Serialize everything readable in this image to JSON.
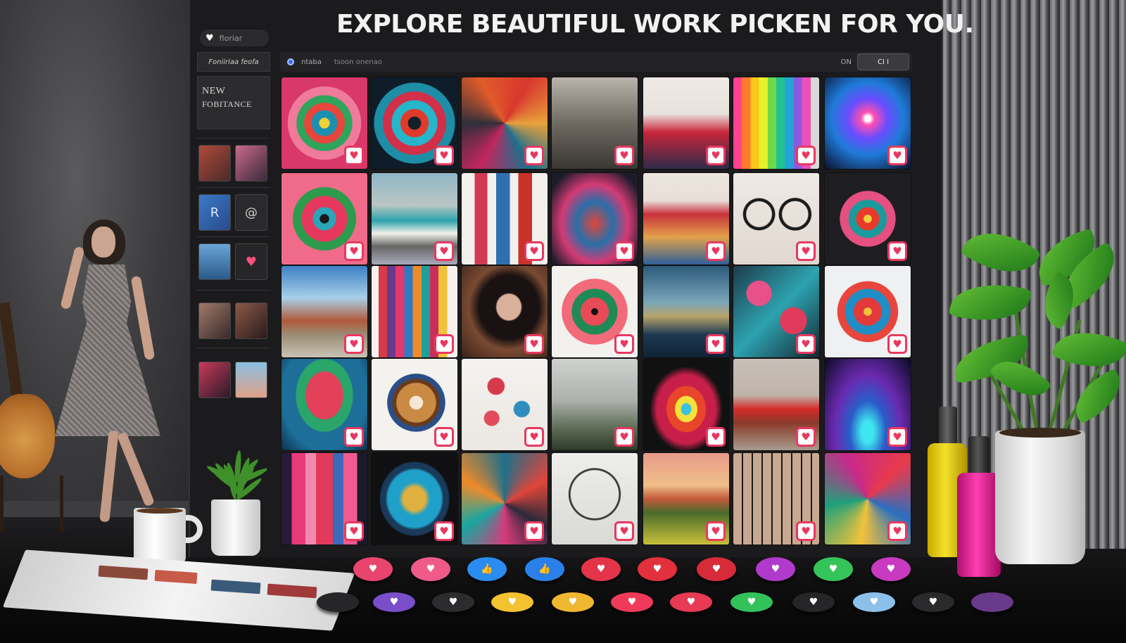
{
  "headline": "EXPLORE BEAUTIFUL WORK PICKEN FOR YOU.",
  "sidebar": {
    "pill_label": "floriar",
    "heart_icon": "heart-icon",
    "tag_label": "Foniiriaa feofa",
    "card_line1": "NEW",
    "card_line2": "FOBITANCE"
  },
  "topbar": {
    "label1": "ntaba",
    "label2": "tsoon onenao",
    "zoom": "ON",
    "control": "CI I"
  },
  "like_glyph": "♥",
  "tiles": [
    {
      "name": "tile-mandala-flowers",
      "bg": "radial-gradient(circle at 50% 50%, #f0d23a 0 8%, #1c8fb0 9% 20%, #e8453c 21% 32%, #2fa45c 33% 44%, #f07a9a 45% 58%, #d9386a 59% 100%)"
    },
    {
      "name": "tile-teal-mandala",
      "bg": "radial-gradient(circle at 50% 50%, #142028 0 10%, #e23a2a 11% 22%, #26b5c9 23% 36%, #d22f48 37% 50%, #1d8ea6 51% 64%, #0f1d2a 65% 100%)"
    },
    {
      "name": "tile-color-collage",
      "bg": "conic-gradient(from 30deg, #d8372e, #e9a13b, #1f6f8c, #c0265e, #2f2f3a, #e15b2a, #d8372e)"
    },
    {
      "name": "tile-window-room",
      "bg": "linear-gradient(180deg, #b9b5ad 0%, #6f6a62 50%, #3a3632 100%)"
    },
    {
      "name": "tile-red-gown",
      "bg": "linear-gradient(180deg, #efeae6 0%, #e8e2dc 40%, #c8263a 60%, #2e2a4a 100%)"
    },
    {
      "name": "tile-color-pencils",
      "bg": "linear-gradient(90deg, #ff3f8f 0 10%, #ff7a2a 10% 20%, #f8c81c 20% 30%, #e5ef2a 30% 40%, #6fd74a 40% 50%, #22c38e 50% 60%, #24a5d8 60% 70%, #8a5ae2 70% 80%, #ee4fb8 80% 90%, #d8d8d8 90% 100%)"
    },
    {
      "name": "tile-light-burst",
      "bg": "radial-gradient(circle at 50% 45%, #ffffff 0 4%, #ff4fb0 10%, #6a4cff 30%, #1f7bd8 55%, #0b0f2a 100%)"
    },
    {
      "name": "tile-flower-mandala",
      "bg": "radial-gradient(circle at 50% 50%, #181818 0 7%, #2aa6b8 8% 18%, #e5385c 19% 36%, #2d9b4c 37% 50%, #f06b8a 51% 100%)"
    },
    {
      "name": "tile-vintage-van",
      "bg": "linear-gradient(180deg, #8fb6c8 0%, #b9c6c2 35%, #2da3ad 52%, #f1f1ea 66%, #666 80%, #aab 100%)"
    },
    {
      "name": "tile-hanging-dresses",
      "bg": "linear-gradient(90deg, #f2f0ec 0 15%, #d23a52 15% 30%, #f2f0ec 30% 40%, #2f6fb0 40% 56%, #f2f0ec 56% 66%, #c83228 66% 82%, #f2f0ec 82% 100%)"
    },
    {
      "name": "tile-floral-coat",
      "bg": "radial-gradient(ellipse at 50% 55%, #e0453a 0%, #2a6fa8 30%, #d43a74 55%, #1c1c2a 85%)"
    },
    {
      "name": "tile-woman-red-hat",
      "bg": "linear-gradient(180deg, #ece6e0 0%, #e8dfd8 30%, #c9323c 45%, #e2a24a 70%, #2e5f9a 100%)"
    },
    {
      "name": "tile-round-glasses",
      "bg": "radial-gradient(circle at 30% 45%, transparent 0 16%, #1a1a1a 17% 20%, transparent 21%), radial-gradient(circle at 72% 45%, transparent 0 16%, #1a1a1a 17% 20%, transparent 21%), linear-gradient(180deg, #efe9e4, #e0d8d0)"
    },
    {
      "name": "tile-dark-mandala",
      "bg": "radial-gradient(circle at 50% 50%, #f0d23a 0 6%, #e83a2a 7% 18%, #1b9a9c 19% 30%, #e45080 31% 44%, #1e1e22 45% 100%)"
    },
    {
      "name": "tile-red-truck-sky",
      "bg": "linear-gradient(180deg, #3b7fc4 0%, #a8d0e8 35%, #b05a3c 60%, #9a8c74 75%, #c9c3b5 100%)"
    },
    {
      "name": "tile-pens",
      "bg": "linear-gradient(90deg, #f6f1ee 0 8%, #d63b47 8% 18%, #6a3a8a 18% 28%, #e2386e 28% 38%, #2f7bc1 38% 48%, #f08a2a 48% 58%, #1f9e9a 58% 68%, #c92e5a 68% 78%, #f2c23a 78% 88%, #f6f1ee 88% 100%)"
    },
    {
      "name": "tile-dark-haired-woman",
      "bg": "radial-gradient(ellipse at 55% 45%, #d9b09a 0 18%, #1a1212 20% 45%, #7a4a32 60%, #3a241a 100%)"
    },
    {
      "name": "tile-flower-star",
      "bg": "radial-gradient(circle at 50% 50%, #111 0 5%, #e84a58 6% 22%, #1f8a56 23% 36%, #f26b7a 37% 52%, #f3f1ee 53% 100%)"
    },
    {
      "name": "tile-misty-lake",
      "bg": "linear-gradient(180deg, #2b5a7a 0%, #7aa6b9 40%, #b7a46a 55%, #1d3a52 75%, #0f2234 100%)"
    },
    {
      "name": "tile-rose-cluster",
      "bg": "radial-gradient(circle at 30% 30%, #e8508a 0 14%, transparent 15%), radial-gradient(circle at 70% 60%, #e23a5a 0 16%, transparent 17%), linear-gradient(135deg, #1d3a4a, #2ea3b0 50%, #14262f)"
    },
    {
      "name": "tile-paper-flower",
      "bg": "radial-gradient(circle at 50% 50%, #f2c23a 0 6%, #e23a3a 7% 22%, #1f8ec5 23% 36%, #e8453c 37% 48%, #eef0f2 49% 100%)"
    },
    {
      "name": "tile-flower-heart",
      "bg": "radial-gradient(ellipse at 50% 40%, #e3405a 0 30%, #2aa66a 32% 46%, #1d6f9a 48% 70%, #0f2e4a 100%)"
    },
    {
      "name": "tile-latte-art",
      "bg": "radial-gradient(circle at 52% 48%, #f4e7d6 0 10%, #c98a44 11% 30%, #6a3a1a 31% 36%, #2a4f86 37% 44%, #f4f2ee 45% 100%)"
    },
    {
      "name": "tile-scattered-flowers",
      "bg": "radial-gradient(circle at 40% 30%, #d83a4c 0 10%, transparent 11%), radial-gradient(circle at 70% 55%, #2f8ebf 0 10%, transparent 11%), radial-gradient(circle at 35% 65%, #e04a5a 0 9%, transparent 10%), linear-gradient(180deg, #f4f2ef, #ebe7e2)"
    },
    {
      "name": "tile-eiffel-tower",
      "bg": "linear-gradient(180deg, #cfd1cf 0%, #aeb2ae 45%, #5f6e58 75%, #2f3a2a 100%)"
    },
    {
      "name": "tile-rainbow-burst",
      "bg": "radial-gradient(ellipse at 50% 55%, #3ac0e0 0 8%, #f2e23a 9% 18%, #e8452a 19% 32%, #c81f4a 33% 48%, #111 60% 100%)"
    },
    {
      "name": "tile-red-truck",
      "bg": "linear-gradient(180deg, #c8c0b8 0%, #bfb4aa 40%, #d42a2a 55%, #8a3a2a 70%, #a89c8e 100%)"
    },
    {
      "name": "tile-sparkle-lights",
      "bg": "radial-gradient(ellipse at 50% 80%, #3ee6f0 0 10%, #2a5cc8 30%, #6a2ab0 55%, #0a0a22 100%)"
    },
    {
      "name": "tile-pink-drapes",
      "bg": "linear-gradient(90deg, #2a1a3a 0 12%, #e83a7a 12% 28%, #f28ab0 28% 40%, #e23a5a 40% 60%, #3a6ab8 60% 72%, #f05a90 72% 88%, #1a1a2a 88% 100%)"
    },
    {
      "name": "tile-ocean-bowl",
      "bg": "radial-gradient(ellipse at 50% 50%, #e0b040 0 18%, #1fa0c8 26% 44%, #1a3a5a 48% 56%, #101012 58% 100%)"
    },
    {
      "name": "tile-abstract-figure",
      "bg": "conic-gradient(from 0deg at 50% 55%, #1f6f8a, #e0453a, #2a2a3a, #d63a7a, #1aa6a0, #f08a2a, #1f6f8a)"
    },
    {
      "name": "tile-ferris-wheel",
      "bg": "radial-gradient(circle at 50% 45%, transparent 0 36%, #3a3a3a 37% 39%, transparent 40%), linear-gradient(180deg, #eeeeec, #d9d9d6)"
    },
    {
      "name": "tile-sunset-field",
      "bg": "linear-gradient(180deg, #e89a8a 0%, #f0c08a 35%, #c45a3a 50%, #4a6a2a 65%, #c9c03a 100%)"
    },
    {
      "name": "tile-photo-grid",
      "bg": "repeating-linear-gradient(90deg, #c8a890 0 12px, #1a1a1a 12px 14px), repeating-linear-gradient(180deg, #3a7ab0 0 14px, #1a1a1a 14px 16px)"
    },
    {
      "name": "tile-swirl-plate",
      "bg": "conic-gradient(from 45deg, #e83a4c, #2a6fc0, #f2c23a, #1fa07a, #c82a8a, #e83a4c)"
    }
  ],
  "floor_buttons": [
    {
      "color": "#e8446e",
      "glyph": "♥"
    },
    {
      "color": "#ef5a8a",
      "glyph": "♥"
    },
    {
      "color": "#2a8cf0",
      "glyph": "👍"
    },
    {
      "color": "#2a80e8",
      "glyph": "👍"
    },
    {
      "color": "#e3344a",
      "glyph": "♥"
    },
    {
      "color": "#e2303c",
      "glyph": "♥"
    },
    {
      "color": "#d82b3a",
      "glyph": "♥"
    },
    {
      "color": "#b03acb",
      "glyph": "♥"
    },
    {
      "color": "#35c45a",
      "glyph": "♥"
    },
    {
      "color": "#c83ac0",
      "glyph": "♥"
    },
    {
      "color": "#262628",
      "glyph": ""
    },
    {
      "color": "#7a4ec8",
      "glyph": "♥"
    },
    {
      "color": "#2c2c2e",
      "glyph": "♥"
    },
    {
      "color": "#f2c230",
      "glyph": "♥"
    },
    {
      "color": "#f0b830",
      "glyph": "♥"
    },
    {
      "color": "#ef3a5a",
      "glyph": "♥"
    },
    {
      "color": "#e63a55",
      "glyph": "♥"
    },
    {
      "color": "#33c25a",
      "glyph": "♥"
    },
    {
      "color": "#262628",
      "glyph": "♥"
    },
    {
      "color": "#8cc0e8",
      "glyph": "♥"
    },
    {
      "color": "#2a2a2c",
      "glyph": "♥"
    },
    {
      "color": "#6a3a8a",
      "glyph": ""
    }
  ],
  "colors": {
    "accent_like": "#e8385f",
    "panel_bg": "#1b1b1d",
    "headline": "#f2f2f2"
  }
}
